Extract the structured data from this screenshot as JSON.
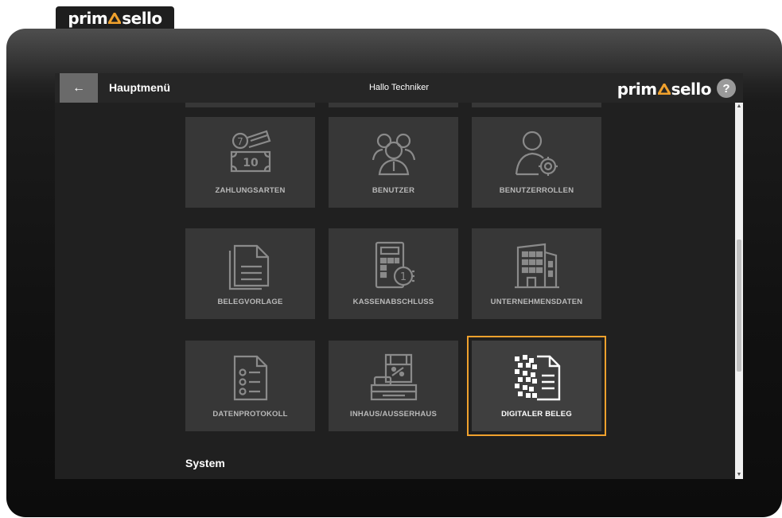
{
  "brand": {
    "name_left": "prim",
    "name_right": "sello",
    "accent": "#f0a12d"
  },
  "header": {
    "back_icon": "arrow-left-icon",
    "back_glyph": "←",
    "title": "Hauptmenü",
    "greeting": "Hallo Techniker",
    "help_label": "?"
  },
  "tiles": [
    {
      "label": "ZAHLUNGSARTEN",
      "icon": "payment-methods-icon"
    },
    {
      "label": "BENUTZER",
      "icon": "users-icon"
    },
    {
      "label": "BENUTZERROLLEN",
      "icon": "user-roles-icon"
    },
    {
      "label": "BELEGVORLAGE",
      "icon": "receipt-template-icon"
    },
    {
      "label": "KASSENABSCHLUSS",
      "icon": "cash-closing-icon"
    },
    {
      "label": "UNTERNEHMENSDATEN",
      "icon": "company-data-icon"
    },
    {
      "label": "DATENPROTOKOLL",
      "icon": "data-log-icon"
    },
    {
      "label": "INHAUS/AUSSERHAUS",
      "icon": "inhouse-outhouse-icon"
    },
    {
      "label": "DIGITALER BELEG",
      "icon": "digital-receipt-icon",
      "selected": true
    }
  ],
  "payment_icon_text": {
    "coin": "7",
    "bill": "10"
  },
  "cash_icon_text": {
    "coin": "1"
  },
  "section": {
    "label": "System"
  },
  "scrollbar": {
    "up_glyph": "▲",
    "down_glyph": "▼"
  }
}
